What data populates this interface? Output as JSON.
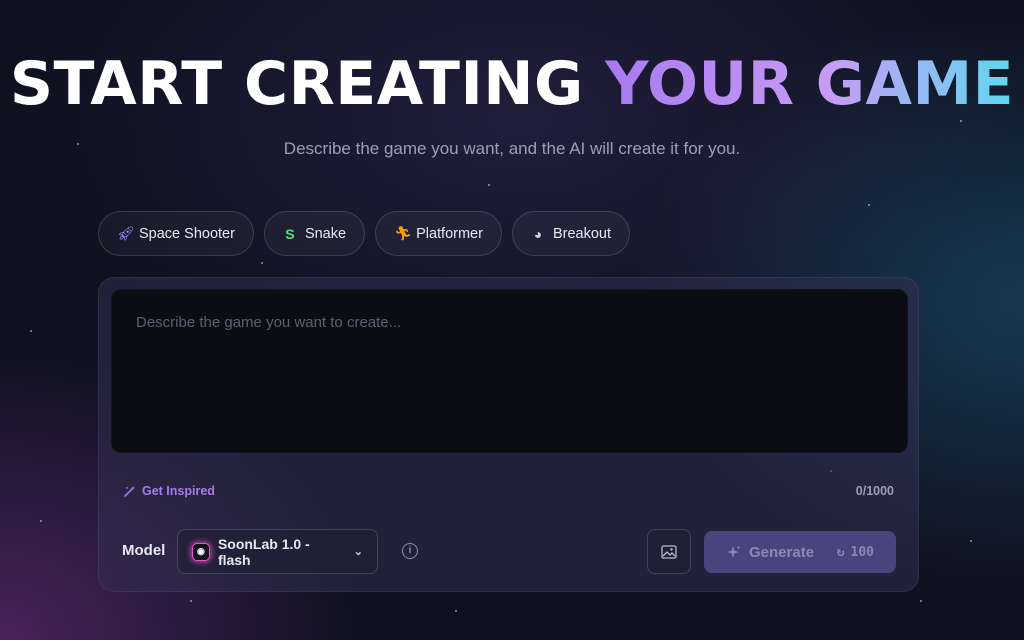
{
  "hero": {
    "title_part1": "START CREATING ",
    "title_part2": "YOUR GAME",
    "subtitle": "Describe the game you want, and the AI will create it for you."
  },
  "chips": [
    {
      "label": "Space Shooter",
      "icon": "rocket-icon",
      "icon_color": "#a78bfa"
    },
    {
      "label": "Snake",
      "icon": "snake-icon",
      "icon_color": "#4ade80"
    },
    {
      "label": "Platformer",
      "icon": "runner-icon",
      "icon_color": "#f59e0b"
    },
    {
      "label": "Breakout",
      "icon": "ball-icon",
      "icon_color": "#cbd5e1"
    }
  ],
  "prompt": {
    "placeholder": "Describe the game you want to create...",
    "value": "",
    "char_count": "0/1000"
  },
  "get_inspired": {
    "label": "Get Inspired",
    "icon": "magic-wand-icon",
    "color": "#a77bf0"
  },
  "model": {
    "label": "Model",
    "selected": "SoonLab 1.0 - flash"
  },
  "generate": {
    "label": "Generate",
    "credits": "100",
    "color": "#4a437e"
  }
}
